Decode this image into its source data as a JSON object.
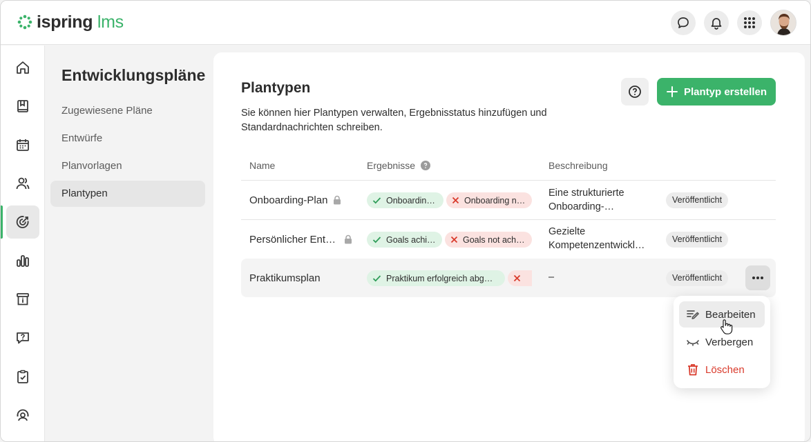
{
  "header": {
    "logo_part1": "ispring",
    "logo_part2": "lms",
    "icons": [
      "chat-icon",
      "bell-icon",
      "apps-grid-icon"
    ],
    "brand_color": "#3bb36a"
  },
  "rail": {
    "icons": [
      "home-icon",
      "book-icon",
      "calendar-icon",
      "users-icon",
      "target-icon",
      "bar-chart-icon",
      "info-box-icon",
      "question-chat-icon",
      "clipboard-check-icon",
      "support-agent-icon"
    ],
    "active": "target-icon"
  },
  "subnav": {
    "title": "Entwicklungspläne",
    "items": [
      {
        "label": "Zugewiesene Pläne"
      },
      {
        "label": "Entwürfe"
      },
      {
        "label": "Planvorlagen"
      },
      {
        "label": "Plantypen"
      }
    ],
    "active_index": 3
  },
  "main": {
    "title": "Plantypen",
    "description": "Sie können hier Plantypen verwalten, Ergebnisstatus hinzufügen und Standardnachrichten schreiben.",
    "create_button": "Plantyp erstellen",
    "columns": {
      "name": "Name",
      "results": "Ergebnisse",
      "description": "Beschreibung"
    },
    "rows": [
      {
        "name": "Onboarding-Plan",
        "locked": true,
        "result_ok": "Onboardin…",
        "result_fail": "Onboarding n…",
        "description": "Eine strukturierte Onboarding-…",
        "status": "Veröffentlicht"
      },
      {
        "name": "Persönlicher Ent…",
        "locked": true,
        "result_ok": "Goals achi…",
        "result_fail": "Goals not ach…",
        "description": "Gezielte Kompetenzentwickl…",
        "status": "Veröffentlicht"
      },
      {
        "name": "Praktikumsplan",
        "locked": false,
        "result_ok": "Praktikum erfolgreich abg…",
        "result_fail": "",
        "description": "–",
        "status": "Veröffentlicht"
      }
    ]
  },
  "menu": {
    "items": [
      {
        "label": "Bearbeiten",
        "icon": "edit-icon"
      },
      {
        "label": "Verbergen",
        "icon": "eye-closed-icon"
      },
      {
        "label": "Löschen",
        "icon": "trash-icon"
      }
    ],
    "danger_color": "#d93a2b"
  }
}
